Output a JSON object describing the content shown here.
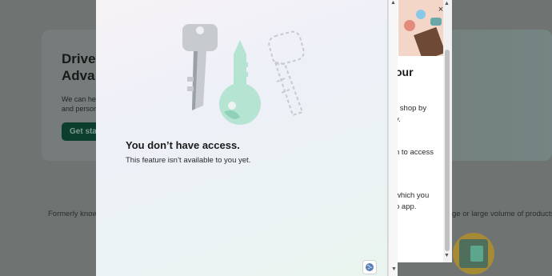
{
  "background": {
    "card_title": "Drive\nAdva",
    "card_text": "We can hel\nand person",
    "card_button": "Get start",
    "former_left": "Formerly known",
    "former_right": "ge or large volume of products."
  },
  "side_panel": {
    "close_icon": "×",
    "heading": "our",
    "line1": "r shop by",
    "line2": "y.",
    "line3": "n to access",
    "line4": "which you",
    "line5": "o app."
  },
  "dialog": {
    "title": "You don’t have access.",
    "subtitle": "This feature isn’t available to you yet.",
    "icon_names": [
      "key-illustration",
      "globe-icon"
    ]
  },
  "colors": {
    "accent_green": "#0b3e2c",
    "key_mint": "#b6e4d3",
    "key_gray": "#c7cbd0"
  }
}
